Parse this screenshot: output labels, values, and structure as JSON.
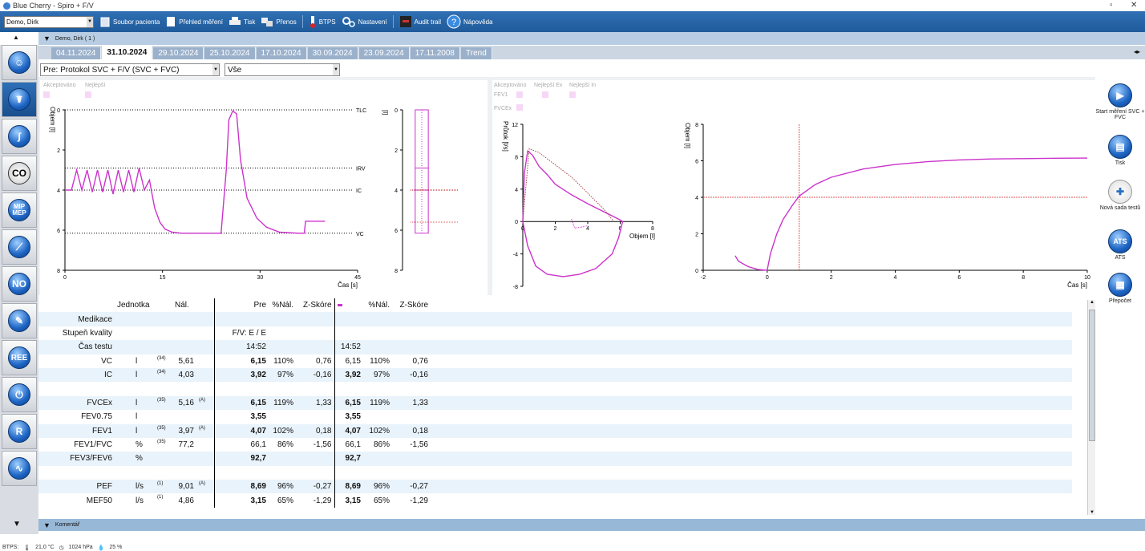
{
  "window": {
    "title": "Blue Cherry - Spiro + F/V"
  },
  "toolbar": {
    "patient": "Demo, Dirk",
    "items": [
      {
        "label": "Soubor pacienta"
      },
      {
        "label": "Přehled měření"
      },
      {
        "label": "Tisk"
      },
      {
        "label": "Přenos"
      },
      {
        "label": "BTPS"
      },
      {
        "label": "Nastavení"
      },
      {
        "label": "Audit trail"
      },
      {
        "label": "Nápověda"
      }
    ]
  },
  "subheader": {
    "label": "Demo, Dirk ( 1 )"
  },
  "tabs": [
    "04.11.2024",
    "31.10.2024",
    "29.10.2024",
    "25.10.2024",
    "17.10.2024",
    "30.09.2024",
    "23.09.2024",
    "17.11.2008",
    "Trend"
  ],
  "selected_tab": "31.10.2024",
  "filters": {
    "protocol": "Pre: Protokol SVC + F/V (SVC + FVC)",
    "scope": "Vše"
  },
  "legends": {
    "left": [
      "Akceptováno",
      "Nejlepší"
    ],
    "right": [
      "Akceptováno",
      "Nejlepší Ex",
      "Nejlepší In",
      "FEV1",
      "FVCEx"
    ]
  },
  "chart_data": [
    {
      "type": "line",
      "xlabel": "Čas [s]",
      "ylabel": "Objem [l]",
      "xlim": [
        0,
        45
      ],
      "ylim": [
        8,
        0
      ],
      "xticks": [
        0,
        15,
        30,
        45
      ],
      "yticks": [
        0,
        2,
        4,
        6,
        8
      ],
      "reference_lines": [
        {
          "label": "TLC",
          "y": 0
        },
        {
          "label": "IRV",
          "y": 2.9
        },
        {
          "label": "IC",
          "y": 4.0
        },
        {
          "label": "VC",
          "y": 6.15
        }
      ],
      "color": "#cc33cc",
      "series": [
        {
          "x": [
            0,
            1,
            1.8,
            2.6,
            3.4,
            4.2,
            5,
            5.8,
            6.6,
            7.4,
            8.2,
            9,
            9.8,
            10.6,
            11.4,
            12.2,
            13,
            13.8,
            14.6,
            15.4,
            16.5,
            18,
            20,
            24,
            24.8,
            25.2,
            25.8,
            26.4,
            27,
            28,
            29.5,
            31,
            33,
            36,
            36.8,
            37,
            38.5,
            40
          ],
          "y": [
            4.0,
            4.0,
            3.0,
            4.0,
            3.0,
            4.1,
            3.0,
            4.1,
            3.0,
            4.2,
            3.0,
            4.1,
            3.0,
            4.1,
            2.9,
            4.0,
            3.5,
            4.9,
            5.6,
            5.95,
            6.1,
            6.15,
            6.15,
            6.15,
            3.0,
            0.5,
            0.05,
            0.2,
            2.5,
            4.4,
            5.4,
            5.85,
            6.1,
            6.15,
            6.15,
            5.55,
            5.55,
            5.55
          ]
        }
      ]
    },
    {
      "type": "bar",
      "ylabel": "[l]",
      "ylim": [
        8,
        0
      ],
      "yticks": [
        0,
        2,
        4,
        6,
        8
      ],
      "reference_lines": [
        {
          "y": 4.0
        },
        {
          "y": 5.6
        }
      ],
      "values": [
        {
          "label": "IRV",
          "from": 0,
          "to": 2.9
        },
        {
          "label": "IC",
          "from": 2.9,
          "to": 4.0
        },
        {
          "label": "VC",
          "from": 4.0,
          "to": 6.15
        }
      ]
    },
    {
      "type": "line",
      "xlabel": "Objem [l]",
      "ylabel": "Průtok [l/s]",
      "xlim": [
        0,
        8
      ],
      "ylim": [
        -8,
        12
      ],
      "xticks": [
        0,
        2,
        4,
        6,
        8
      ],
      "yticks": [
        -8,
        -4,
        0,
        4,
        8,
        12
      ],
      "series": [
        {
          "name": "Ex",
          "x": [
            0,
            0.1,
            0.3,
            0.6,
            1,
            1.5,
            2,
            3,
            4,
            5,
            6,
            6.15
          ],
          "y": [
            0,
            6,
            8.7,
            8.2,
            6.8,
            5.8,
            4.6,
            3.3,
            2.2,
            1.2,
            0.2,
            0
          ]
        },
        {
          "name": "In",
          "x": [
            0,
            0.3,
            0.8,
            1.5,
            2.5,
            3.5,
            4.5,
            5.5,
            5.9,
            6.15
          ],
          "y": [
            0,
            -3,
            -5.5,
            -6.5,
            -6.8,
            -6.5,
            -5.8,
            -4,
            -2,
            0
          ]
        },
        {
          "name": "Nál.",
          "style": "dotted",
          "x": [
            0,
            0.4,
            1,
            2,
            3,
            4,
            5,
            5.6
          ],
          "y": [
            0,
            9.0,
            8.5,
            7.0,
            5.5,
            3.5,
            1.5,
            0
          ]
        }
      ]
    },
    {
      "type": "line",
      "xlabel": "Čas [s]",
      "ylabel": "Objem [l]",
      "xlim": [
        -2,
        10
      ],
      "ylim": [
        0,
        8
      ],
      "xticks": [
        -2,
        0,
        2,
        4,
        6,
        8,
        10
      ],
      "yticks": [
        0,
        2,
        4,
        6,
        8
      ],
      "reference_lines": [
        {
          "x": 1.0
        },
        {
          "y": 4.0
        }
      ],
      "series": [
        {
          "x": [
            -1,
            -0.9,
            -0.6,
            -0.3,
            0,
            0.1,
            0.3,
            0.5,
            0.8,
            1,
            1.5,
            2,
            3,
            4,
            5,
            6,
            7,
            8,
            9,
            10
          ],
          "y": [
            0.8,
            0.5,
            0.2,
            0.05,
            0,
            0.9,
            2.0,
            2.8,
            3.6,
            4.07,
            4.7,
            5.1,
            5.55,
            5.8,
            5.95,
            6.05,
            6.1,
            6.12,
            6.14,
            6.15
          ]
        }
      ]
    }
  ],
  "table": {
    "headers": [
      "",
      "Jednotka",
      "Nál.",
      "",
      "Pre",
      "%Nál.",
      "Z-Skóre",
      "",
      "%Nál.",
      "Z-Skóre"
    ],
    "rows": [
      {
        "label": "Medikace",
        "unit": "",
        "note": "",
        "ref": "",
        "flag": "",
        "pre": "",
        "pct": "",
        "z": "",
        "best": "",
        "bpct": "",
        "bz": ""
      },
      {
        "label": "Stupeň kvality",
        "unit": "",
        "note": "",
        "ref": "",
        "flag": "",
        "pre": "F/V: E / E",
        "pct": "",
        "z": "",
        "best": "",
        "bpct": "",
        "bz": ""
      },
      {
        "label": "Čas testu",
        "unit": "",
        "note": "",
        "ref": "",
        "flag": "",
        "pre": "14:52",
        "pct": "",
        "z": "",
        "best": "14:52",
        "bpct": "",
        "bz": ""
      },
      {
        "label": "VC",
        "unit": "l",
        "note": "(34)",
        "ref": "5,61",
        "flag": "",
        "pre": "6,15",
        "pct": "110%",
        "z": "0,76",
        "best": "6,15",
        "bpct": "110%",
        "bz": "0,76"
      },
      {
        "label": "IC",
        "unit": "l",
        "note": "(34)",
        "ref": "4,03",
        "flag": "",
        "pre": "3,92",
        "pct": "97%",
        "z": "-0,16",
        "best": "3,92",
        "bpct": "97%",
        "bz": "-0,16"
      },
      {
        "label": "",
        "unit": "",
        "note": "",
        "ref": "",
        "flag": "",
        "pre": "",
        "pct": "",
        "z": "",
        "best": "",
        "bpct": "",
        "bz": ""
      },
      {
        "label": "FVCEx",
        "unit": "l",
        "note": "(35)",
        "ref": "5,16",
        "flag": "(A)",
        "pre": "6,15",
        "pct": "119%",
        "z": "1,33",
        "best": "6,15",
        "bpct": "119%",
        "bz": "1,33"
      },
      {
        "label": "FEV0.75",
        "unit": "l",
        "note": "",
        "ref": "",
        "flag": "",
        "pre": "3,55",
        "pct": "",
        "z": "",
        "best": "3,55",
        "bpct": "",
        "bz": ""
      },
      {
        "label": "FEV1",
        "unit": "l",
        "note": "(35)",
        "ref": "3,97",
        "flag": "(A)",
        "pre": "4,07",
        "pct": "102%",
        "z": "0,18",
        "best": "4,07",
        "bpct": "102%",
        "bz": "0,18"
      },
      {
        "label": "FEV1/FVC",
        "unit": "%",
        "note": "(35)",
        "ref": "77,2",
        "flag": "",
        "pre": "66,1",
        "pct": "86%",
        "z": "-1,56",
        "best": "66,1",
        "bpct": "86%",
        "bz": "-1,56"
      },
      {
        "label": "FEV3/FEV6",
        "unit": "%",
        "note": "",
        "ref": "",
        "flag": "",
        "pre": "92,7",
        "pct": "",
        "z": "",
        "best": "92,7",
        "bpct": "",
        "bz": ""
      },
      {
        "label": "",
        "unit": "",
        "note": "",
        "ref": "",
        "flag": "",
        "pre": "",
        "pct": "",
        "z": "",
        "best": "",
        "bpct": "",
        "bz": ""
      },
      {
        "label": "PEF",
        "unit": "l/s",
        "note": "(1)",
        "ref": "9,01",
        "flag": "(A)",
        "pre": "8,69",
        "pct": "96%",
        "z": "-0,27",
        "best": "8,69",
        "bpct": "96%",
        "bz": "-0,27"
      },
      {
        "label": "MEF50",
        "unit": "l/s",
        "note": "(1)",
        "ref": "4,86",
        "flag": "",
        "pre": "3,15",
        "pct": "65%",
        "z": "-1,29",
        "best": "3,15",
        "bpct": "65%",
        "bz": "-1,29"
      }
    ]
  },
  "right_buttons": [
    {
      "label": "Start měření SVC + FVC"
    },
    {
      "label": "Tisk"
    },
    {
      "label": "Nová sada testů"
    },
    {
      "label": "ATS"
    },
    {
      "label": "Přepočet"
    }
  ],
  "left_buttons": [
    "",
    "",
    "",
    "CO",
    "MIP MEP",
    "",
    "NO",
    "",
    "REE",
    "",
    "R",
    ""
  ],
  "bottom": {
    "label": "Komentář"
  },
  "status": {
    "btps": "BTPS:",
    "temp": "21,0 °C",
    "pressure": "1024 hPa",
    "humidity": "25 %"
  },
  "colors": {
    "accent": "#cc33cc",
    "toolbar": "#2f6fb3",
    "tab": "#9bb1cb"
  }
}
